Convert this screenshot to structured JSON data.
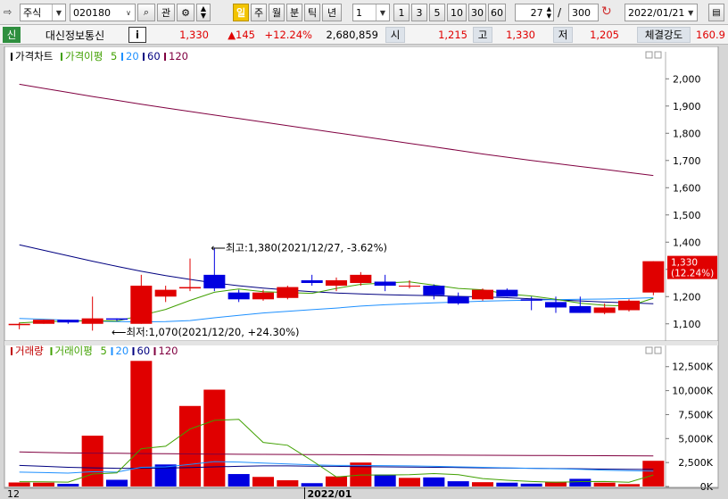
{
  "toolbar": {
    "market": "주식",
    "code": "020180",
    "btn_gwan": "관",
    "period_tabs": [
      "일",
      "주",
      "월",
      "분",
      "틱",
      "년"
    ],
    "interval": "1",
    "unit_buttons": [
      "1",
      "3",
      "5",
      "10",
      "30",
      "60"
    ],
    "count_view": "27",
    "slash": "/",
    "count_total": "300",
    "date": "2022/01/21"
  },
  "infobar": {
    "credit": "신",
    "name": "대신정보통신",
    "info_btn": "i",
    "price": "1,330",
    "change": "▲145",
    "change_pct": "+12.24%",
    "volume": "2,680,859",
    "open_label": "시",
    "open": "1,215",
    "high_label": "고",
    "high": "1,330",
    "low_label": "저",
    "low": "1,205",
    "strength_label": "체결강도",
    "strength": "160.9"
  },
  "chart_data": [
    {
      "type": "candlestick",
      "legend": [
        "가격차트",
        "가격이평",
        "5",
        "20",
        "60",
        "120"
      ],
      "colors": {
        "up": "#e00000",
        "down": "#0000e0",
        "ma5": "#40a000",
        "ma20": "#1e90ff",
        "ma60": "#000080",
        "ma120": "#800040"
      },
      "ylim": [
        1050,
        2060
      ],
      "yticks": [
        1100,
        1200,
        1300,
        1400,
        1500,
        1600,
        1700,
        1800,
        1900,
        2000
      ],
      "ytick_labels": [
        "1,100",
        "1,200",
        "1,300",
        "1,400",
        "1,500",
        "1,600",
        "1,700",
        "1,800",
        "1,900",
        "2,000"
      ],
      "ohlc": [
        [
          1095,
          1105,
          1080,
          1100
        ],
        [
          1100,
          1115,
          1100,
          1115
        ],
        [
          1115,
          1115,
          1100,
          1105
        ],
        [
          1100,
          1200,
          1075,
          1120
        ],
        [
          1120,
          1120,
          1110,
          1115
        ],
        [
          1100,
          1280,
          1100,
          1240
        ],
        [
          1200,
          1240,
          1180,
          1225
        ],
        [
          1230,
          1340,
          1220,
          1235
        ],
        [
          1280,
          1380,
          1220,
          1230
        ],
        [
          1215,
          1225,
          1180,
          1190
        ],
        [
          1190,
          1225,
          1185,
          1215
        ],
        [
          1195,
          1240,
          1190,
          1235
        ],
        [
          1260,
          1280,
          1240,
          1250
        ],
        [
          1240,
          1270,
          1220,
          1260
        ],
        [
          1250,
          1290,
          1240,
          1280
        ],
        [
          1255,
          1280,
          1220,
          1240
        ],
        [
          1240,
          1260,
          1230,
          1240
        ],
        [
          1240,
          1245,
          1190,
          1205
        ],
        [
          1200,
          1215,
          1170,
          1175
        ],
        [
          1190,
          1230,
          1185,
          1225
        ],
        [
          1225,
          1230,
          1200,
          1200
        ],
        [
          1190,
          1200,
          1150,
          1185
        ],
        [
          1180,
          1200,
          1140,
          1160
        ],
        [
          1165,
          1200,
          1140,
          1140
        ],
        [
          1140,
          1175,
          1135,
          1160
        ],
        [
          1150,
          1190,
          1145,
          1185
        ],
        [
          1215,
          1330,
          1205,
          1330
        ]
      ],
      "ma5": [
        1103,
        1108,
        1109,
        1112,
        1110,
        1131,
        1153,
        1186,
        1216,
        1228,
        1218,
        1215,
        1212,
        1230,
        1245,
        1250,
        1254,
        1242,
        1230,
        1225,
        1210,
        1202,
        1190,
        1176,
        1168,
        1165,
        1194
      ],
      "ma20": [
        1120,
        1117,
        1113,
        1110,
        1108,
        1107,
        1108,
        1112,
        1122,
        1131,
        1140,
        1146,
        1152,
        1158,
        1165,
        1170,
        1174,
        1177,
        1180,
        1183,
        1185,
        1187,
        1189,
        1190,
        1191,
        1193,
        1196
      ],
      "ma60": [
        1390,
        1370,
        1350,
        1330,
        1311,
        1293,
        1277,
        1263,
        1250,
        1240,
        1231,
        1224,
        1218,
        1213,
        1210,
        1207,
        1205,
        1203,
        1201,
        1199,
        1196,
        1192,
        1188,
        1184,
        1180,
        1177,
        1174
      ],
      "ma120": [
        1980,
        1965,
        1950,
        1935,
        1921,
        1907,
        1893,
        1880,
        1867,
        1854,
        1841,
        1828,
        1815,
        1802,
        1789,
        1776,
        1763,
        1750,
        1737,
        1724,
        1712,
        1700,
        1689,
        1678,
        1667,
        1656,
        1645
      ],
      "annotations": {
        "high": {
          "index": 8,
          "value": 1380,
          "label": "⟵최고:1,380(2021/12/27, -3.62%)"
        },
        "low": {
          "index": 4,
          "value": 1070,
          "label": "⟵최저:1,070(2021/12/20, +24.30%)"
        }
      },
      "last_label": [
        "1,330",
        "(12.24%)"
      ]
    },
    {
      "type": "bar",
      "legend": [
        "거래량",
        "거래이평",
        "5",
        "20",
        "60",
        "120"
      ],
      "ylim": [
        0,
        13500000
      ],
      "yticks": [
        0,
        2500000,
        5000000,
        7500000,
        10000000,
        12500000
      ],
      "ytick_labels": [
        "0K",
        "2,500K",
        "5,000K",
        "7,500K",
        "10,000K",
        "12,500K"
      ],
      "values": [
        420000,
        400000,
        280000,
        5300000,
        700000,
        13100000,
        2300000,
        8400000,
        10100000,
        1300000,
        1000000,
        650000,
        350000,
        1050000,
        2500000,
        1250000,
        900000,
        950000,
        550000,
        450000,
        400000,
        300000,
        500000,
        800000,
        400000,
        250000,
        2680000
      ],
      "up": [
        true,
        true,
        false,
        true,
        false,
        true,
        false,
        true,
        true,
        false,
        true,
        true,
        false,
        true,
        true,
        false,
        true,
        false,
        false,
        true,
        false,
        false,
        true,
        false,
        true,
        true,
        true
      ],
      "ma5": [
        500000,
        480000,
        460000,
        1300000,
        1420000,
        3950000,
        4200000,
        6000000,
        6900000,
        7000000,
        4600000,
        4300000,
        2700000,
        1000000,
        1200000,
        1200000,
        1230000,
        1350000,
        1240000,
        830000,
        650000,
        520000,
        440000,
        510000,
        520000,
        450000,
        1200000
      ],
      "ma20": [
        1500000,
        1450000,
        1400000,
        1550000,
        1500000,
        2000000,
        2050000,
        2300000,
        2600000,
        2550000,
        2450000,
        2350000,
        2250000,
        2200000,
        2200000,
        2180000,
        2150000,
        2100000,
        2050000,
        2000000,
        1950000,
        1900000,
        1850000,
        1800000,
        1700000,
        1650000,
        1600000
      ],
      "ma60": [
        2200000,
        2100000,
        2000000,
        1950000,
        1900000,
        1900000,
        1920000,
        1980000,
        2050000,
        2100000,
        2150000,
        2150000,
        2120000,
        2100000,
        2080000,
        2050000,
        2030000,
        2000000,
        1980000,
        1950000,
        1920000,
        1900000,
        1870000,
        1850000,
        1820000,
        1800000,
        1780000
      ],
      "ma120": [
        3600000,
        3550000,
        3500000,
        3480000,
        3460000,
        3440000,
        3420000,
        3400000,
        3380000,
        3360000,
        3350000,
        3340000,
        3330000,
        3320000,
        3310000,
        3300000,
        3290000,
        3280000,
        3270000,
        3260000,
        3250000,
        3240000,
        3230000,
        3220000,
        3210000,
        3200000,
        3190000
      ]
    }
  ],
  "xaxis": {
    "left_label": "12",
    "month_label": "2022/01",
    "month_index": 12
  }
}
